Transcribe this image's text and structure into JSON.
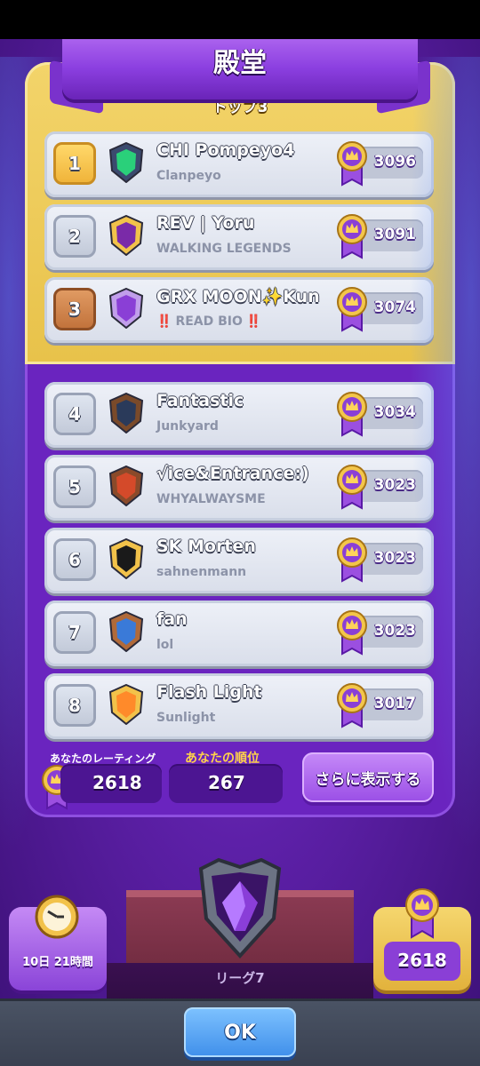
{
  "header": {
    "title": "殿堂"
  },
  "top3": {
    "label": "トップ3"
  },
  "players": [
    {
      "rank": "1",
      "name": "CHI Pompeyo4",
      "clan": "Clanpeyo",
      "score": "3096",
      "rank_style": "gold",
      "badge": "green-gem-badge-icon"
    },
    {
      "rank": "2",
      "name": "REV | Yoru",
      "clan": "WALKING LEGENDS",
      "score": "3091",
      "rank_style": "silver",
      "badge": "skull-badge-icon"
    },
    {
      "rank": "3",
      "name": "GRX MOON✨Kun",
      "clan_mark": "‼️",
      "clan": "READ BIO",
      "clan_mark2": "‼️",
      "score": "3074",
      "rank_style": "bronze",
      "badge": "lightning-badge-icon"
    },
    {
      "rank": "4",
      "name": "Fantastic",
      "clan": "Junkyard",
      "score": "3034",
      "rank_style": "silver",
      "badge": "mask-badge-icon"
    },
    {
      "rank": "5",
      "name": "√ice&Entrance:)",
      "clan": "WHYALWAYSME",
      "score": "3023",
      "rank_style": "silver",
      "badge": "sunset-badge-icon"
    },
    {
      "rank": "6",
      "name": "SK Morten",
      "clan": "sahnenmann",
      "score": "3023",
      "rank_style": "silver",
      "badge": "bamboo-badge-icon"
    },
    {
      "rank": "7",
      "name": "fan",
      "clan": "lol",
      "score": "3023",
      "rank_style": "silver",
      "badge": "arrow-badge-icon"
    },
    {
      "rank": "8",
      "name": "Flash Light",
      "clan": "Sunlight",
      "score": "3017",
      "rank_style": "silver",
      "badge": "flame-badge-icon"
    }
  ],
  "stats": {
    "rating_label": "あなたのレーティング",
    "rating_value": "2618",
    "rank_label": "あなたの順位",
    "rank_value": "267",
    "more_button": "さらに表示する"
  },
  "footer": {
    "timer": "10日 21時間",
    "league": "リーグ7",
    "trophy_value": "2618",
    "ok_button": "OK"
  },
  "colors": {
    "panel": "#6a24bf",
    "top3_gold": "#e8c24a",
    "ok_blue": "#3f8fea"
  }
}
